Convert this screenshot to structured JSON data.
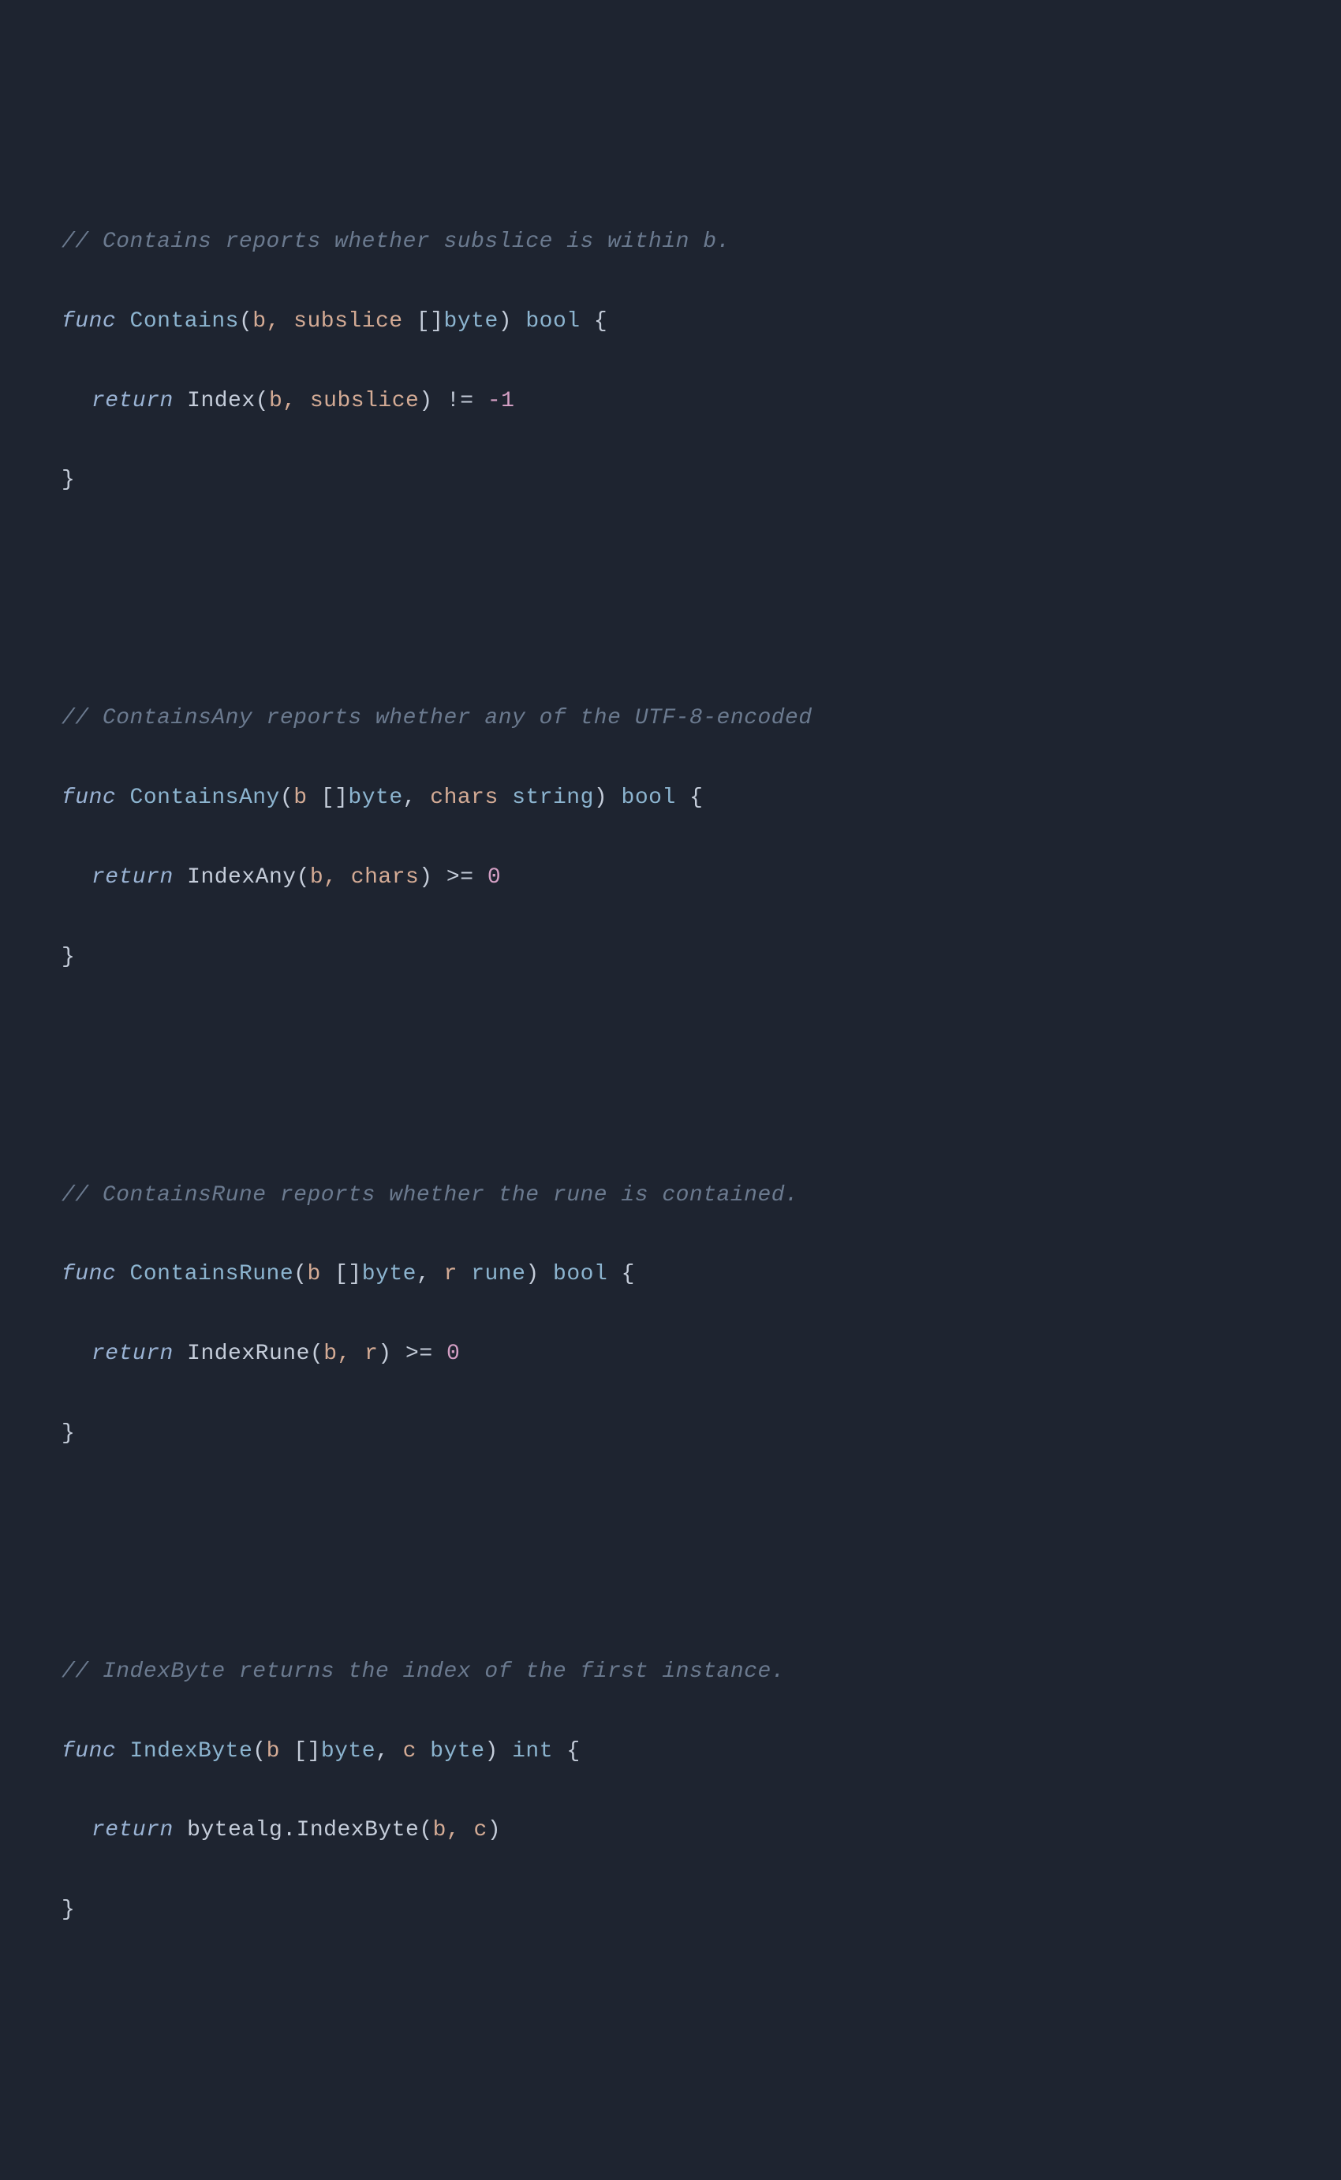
{
  "blocks": [
    {
      "comment": "// Contains reports whether subslice is within b.",
      "sig": {
        "func": "func",
        "name": "Contains",
        "open": "(",
        "params": "b, subslice",
        "ptype_prefix": " []",
        "ptype": "byte",
        "close": ")",
        "ret": "bool",
        "brace": "{"
      },
      "body": {
        "return": "return",
        "call": "Index",
        "open": "(",
        "args": "b, subslice",
        "close": ")",
        "op": "!=",
        "val": "-1"
      },
      "end": "}"
    },
    {
      "comment": "// ContainsAny reports whether any of the UTF-8-encoded",
      "sig": {
        "func": "func",
        "name": "ContainsAny",
        "open": "(",
        "p1": "b",
        "p1t_prefix": " []",
        "p1t": "byte",
        "comma": ",",
        "p2": "chars",
        "p2t": "string",
        "close": ")",
        "ret": "bool",
        "brace": "{"
      },
      "body": {
        "return": "return",
        "call": "IndexAny",
        "open": "(",
        "args": "b, chars",
        "close": ")",
        "op": ">=",
        "val": "0"
      },
      "end": "}"
    },
    {
      "comment": "// ContainsRune reports whether the rune is contained.",
      "sig": {
        "func": "func",
        "name": "ContainsRune",
        "open": "(",
        "p1": "b",
        "p1t_prefix": " []",
        "p1t": "byte",
        "comma": ",",
        "p2": "r",
        "p2t": "rune",
        "close": ")",
        "ret": "bool",
        "brace": "{"
      },
      "body": {
        "return": "return",
        "call": "IndexRune",
        "open": "(",
        "args": "b, r",
        "close": ")",
        "op": ">=",
        "val": "0"
      },
      "end": "}"
    },
    {
      "comment": "// IndexByte returns the index of the first instance.",
      "sig": {
        "func": "func",
        "name": "IndexByte",
        "open": "(",
        "p1": "b",
        "p1t_prefix": " []",
        "p1t": "byte",
        "comma": ",",
        "p2": "c",
        "p2t": "byte",
        "close": ")",
        "ret": "int",
        "brace": "{"
      },
      "body": {
        "return": "return",
        "pkg": "bytealg",
        "dot": ".",
        "call": "IndexByte",
        "open": "(",
        "args": "b, c",
        "close": ")"
      },
      "end": "}"
    }
  ]
}
